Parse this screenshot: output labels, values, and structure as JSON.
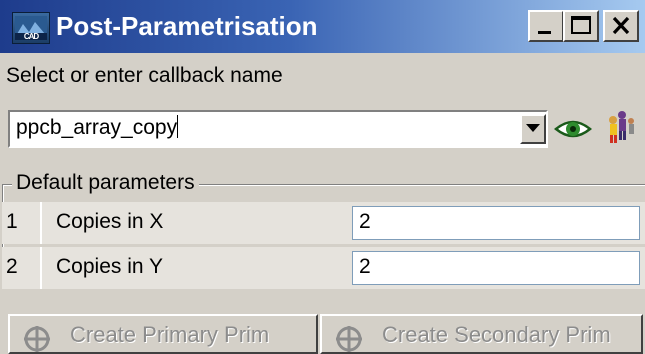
{
  "window": {
    "title": "Post-Parametrisation",
    "icon": "cadd-app-icon",
    "buttons": [
      "minimize",
      "maximize",
      "close"
    ]
  },
  "callback": {
    "prompt": "Select or enter callback name",
    "value": "ppcb_array_copy",
    "icons": [
      "dropdown-arrow-icon",
      "eye-icon",
      "users-icon"
    ]
  },
  "parameters": {
    "group_label": "Default parameters",
    "rows": [
      {
        "index": "1",
        "label": "Copies in X",
        "value": "2"
      },
      {
        "index": "2",
        "label": "Copies in Y",
        "value": "2"
      }
    ]
  },
  "actions": {
    "primary_label": "Create Primary Prim",
    "secondary_label": "Create Secondary Prim"
  }
}
